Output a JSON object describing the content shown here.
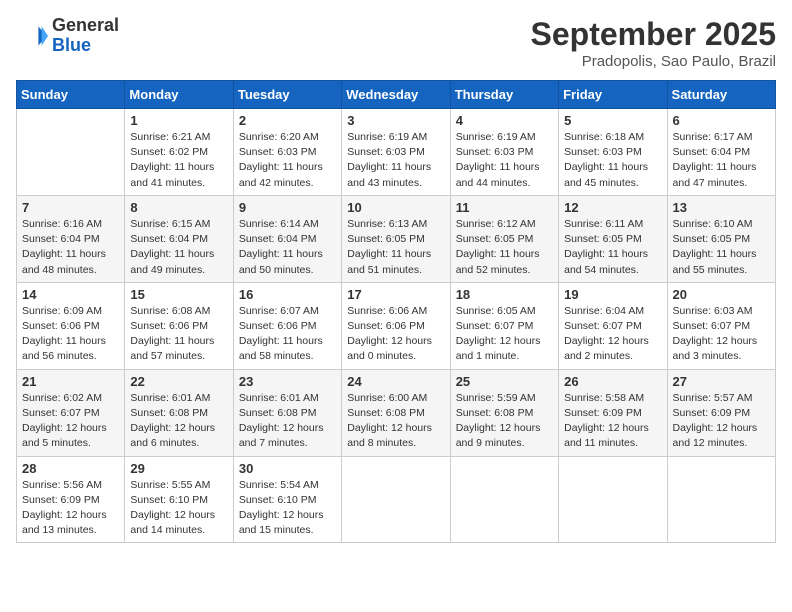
{
  "header": {
    "logo_general": "General",
    "logo_blue": "Blue",
    "month": "September 2025",
    "location": "Pradopolis, Sao Paulo, Brazil"
  },
  "weekdays": [
    "Sunday",
    "Monday",
    "Tuesday",
    "Wednesday",
    "Thursday",
    "Friday",
    "Saturday"
  ],
  "weeks": [
    [
      {
        "day": "",
        "info": ""
      },
      {
        "day": "1",
        "info": "Sunrise: 6:21 AM\nSunset: 6:02 PM\nDaylight: 11 hours\nand 41 minutes."
      },
      {
        "day": "2",
        "info": "Sunrise: 6:20 AM\nSunset: 6:03 PM\nDaylight: 11 hours\nand 42 minutes."
      },
      {
        "day": "3",
        "info": "Sunrise: 6:19 AM\nSunset: 6:03 PM\nDaylight: 11 hours\nand 43 minutes."
      },
      {
        "day": "4",
        "info": "Sunrise: 6:19 AM\nSunset: 6:03 PM\nDaylight: 11 hours\nand 44 minutes."
      },
      {
        "day": "5",
        "info": "Sunrise: 6:18 AM\nSunset: 6:03 PM\nDaylight: 11 hours\nand 45 minutes."
      },
      {
        "day": "6",
        "info": "Sunrise: 6:17 AM\nSunset: 6:04 PM\nDaylight: 11 hours\nand 47 minutes."
      }
    ],
    [
      {
        "day": "7",
        "info": "Sunrise: 6:16 AM\nSunset: 6:04 PM\nDaylight: 11 hours\nand 48 minutes."
      },
      {
        "day": "8",
        "info": "Sunrise: 6:15 AM\nSunset: 6:04 PM\nDaylight: 11 hours\nand 49 minutes."
      },
      {
        "day": "9",
        "info": "Sunrise: 6:14 AM\nSunset: 6:04 PM\nDaylight: 11 hours\nand 50 minutes."
      },
      {
        "day": "10",
        "info": "Sunrise: 6:13 AM\nSunset: 6:05 PM\nDaylight: 11 hours\nand 51 minutes."
      },
      {
        "day": "11",
        "info": "Sunrise: 6:12 AM\nSunset: 6:05 PM\nDaylight: 11 hours\nand 52 minutes."
      },
      {
        "day": "12",
        "info": "Sunrise: 6:11 AM\nSunset: 6:05 PM\nDaylight: 11 hours\nand 54 minutes."
      },
      {
        "day": "13",
        "info": "Sunrise: 6:10 AM\nSunset: 6:05 PM\nDaylight: 11 hours\nand 55 minutes."
      }
    ],
    [
      {
        "day": "14",
        "info": "Sunrise: 6:09 AM\nSunset: 6:06 PM\nDaylight: 11 hours\nand 56 minutes."
      },
      {
        "day": "15",
        "info": "Sunrise: 6:08 AM\nSunset: 6:06 PM\nDaylight: 11 hours\nand 57 minutes."
      },
      {
        "day": "16",
        "info": "Sunrise: 6:07 AM\nSunset: 6:06 PM\nDaylight: 11 hours\nand 58 minutes."
      },
      {
        "day": "17",
        "info": "Sunrise: 6:06 AM\nSunset: 6:06 PM\nDaylight: 12 hours\nand 0 minutes."
      },
      {
        "day": "18",
        "info": "Sunrise: 6:05 AM\nSunset: 6:07 PM\nDaylight: 12 hours\nand 1 minute."
      },
      {
        "day": "19",
        "info": "Sunrise: 6:04 AM\nSunset: 6:07 PM\nDaylight: 12 hours\nand 2 minutes."
      },
      {
        "day": "20",
        "info": "Sunrise: 6:03 AM\nSunset: 6:07 PM\nDaylight: 12 hours\nand 3 minutes."
      }
    ],
    [
      {
        "day": "21",
        "info": "Sunrise: 6:02 AM\nSunset: 6:07 PM\nDaylight: 12 hours\nand 5 minutes."
      },
      {
        "day": "22",
        "info": "Sunrise: 6:01 AM\nSunset: 6:08 PM\nDaylight: 12 hours\nand 6 minutes."
      },
      {
        "day": "23",
        "info": "Sunrise: 6:01 AM\nSunset: 6:08 PM\nDaylight: 12 hours\nand 7 minutes."
      },
      {
        "day": "24",
        "info": "Sunrise: 6:00 AM\nSunset: 6:08 PM\nDaylight: 12 hours\nand 8 minutes."
      },
      {
        "day": "25",
        "info": "Sunrise: 5:59 AM\nSunset: 6:08 PM\nDaylight: 12 hours\nand 9 minutes."
      },
      {
        "day": "26",
        "info": "Sunrise: 5:58 AM\nSunset: 6:09 PM\nDaylight: 12 hours\nand 11 minutes."
      },
      {
        "day": "27",
        "info": "Sunrise: 5:57 AM\nSunset: 6:09 PM\nDaylight: 12 hours\nand 12 minutes."
      }
    ],
    [
      {
        "day": "28",
        "info": "Sunrise: 5:56 AM\nSunset: 6:09 PM\nDaylight: 12 hours\nand 13 minutes."
      },
      {
        "day": "29",
        "info": "Sunrise: 5:55 AM\nSunset: 6:10 PM\nDaylight: 12 hours\nand 14 minutes."
      },
      {
        "day": "30",
        "info": "Sunrise: 5:54 AM\nSunset: 6:10 PM\nDaylight: 12 hours\nand 15 minutes."
      },
      {
        "day": "",
        "info": ""
      },
      {
        "day": "",
        "info": ""
      },
      {
        "day": "",
        "info": ""
      },
      {
        "day": "",
        "info": ""
      }
    ]
  ]
}
